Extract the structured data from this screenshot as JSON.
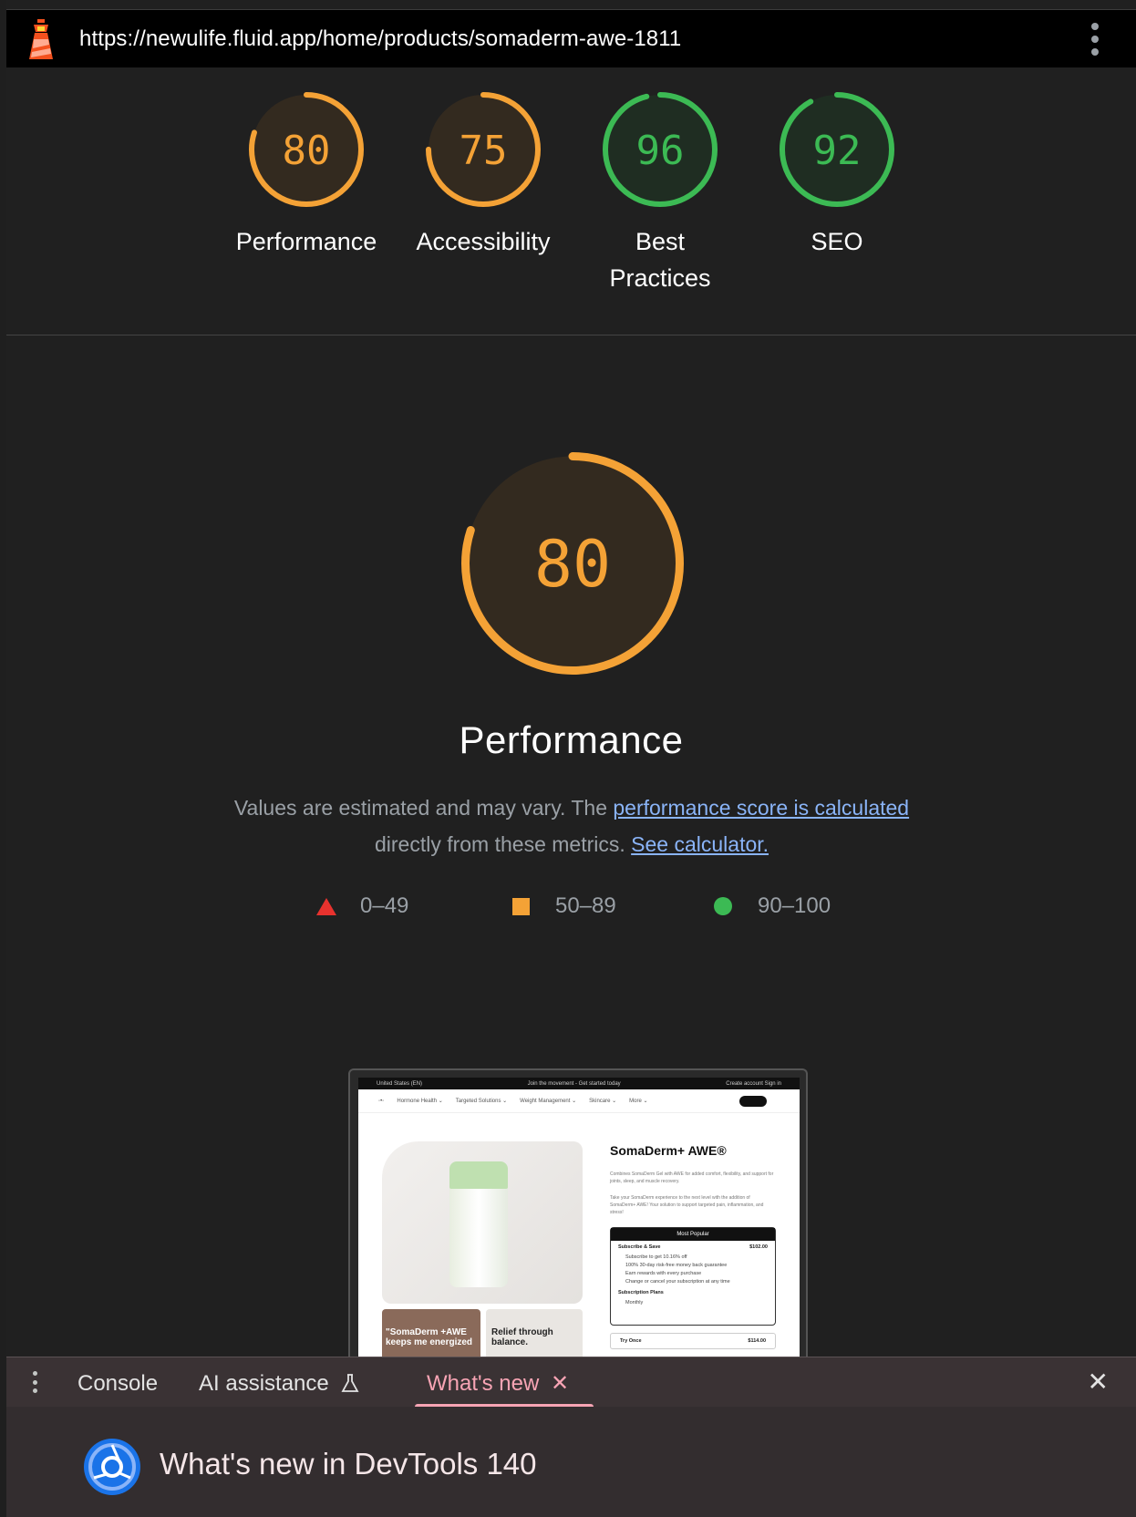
{
  "url_bar": {
    "url": "https://newulife.fluid.app/home/products/somaderm-awe-1811"
  },
  "scores": [
    {
      "label": "Performance",
      "score": "80",
      "value": 80,
      "color": "#f4a236",
      "bg": "#332a1f"
    },
    {
      "label": "Accessibility",
      "score": "75",
      "value": 75,
      "color": "#f4a236",
      "bg": "#332a1f"
    },
    {
      "label": "Best Practices",
      "score": "96",
      "value": 96,
      "color": "#3cba54",
      "bg": "#1f2d22"
    },
    {
      "label": "SEO",
      "score": "92",
      "value": 92,
      "color": "#3cba54",
      "bg": "#1f2d22"
    }
  ],
  "performance": {
    "score": "80",
    "value": 80,
    "title": "Performance",
    "desc_prefix": "Values are estimated and may vary. The ",
    "link1": "performance score is calculated",
    "desc_middle": " directly from these metrics. ",
    "link2": "See calculator."
  },
  "legend": {
    "fail": "0–49",
    "average": "50–89",
    "pass": "90–100"
  },
  "screenshot": {
    "top_left": "United States (EN)",
    "top_center": "Join the movement - Get started today",
    "top_right": "Create account   Sign in",
    "nav": [
      "Hormone Health ⌄",
      "Targeted Solutions ⌄",
      "Weight Management ⌄",
      "Skincare ⌄",
      "More ⌄"
    ],
    "product_title": "SomaDerm+ AWE®",
    "desc1": "Combines SomaDerm Gel with AWE for added comfort, flexibility, and support for joints, sleep, and muscle recovery.",
    "desc2": "Take your SomaDerm experience to the next level with the addition of SomaDerm+ AWE! Your solution to support targeted pain, inflammation, and stress!",
    "box_head": "Most Popular",
    "subscribe_label": "Subscribe & Save",
    "subscribe_price": "$102.00",
    "bullets": [
      "Subscribe to get 10.16% off",
      "100% 30-day risk-free money back guarantee",
      "Earn rewards with every purchase",
      "Change or cancel your subscription at any time"
    ],
    "plans_label": "Subscription Plans",
    "plans_value": "Monthly",
    "try_label": "Try Once",
    "try_price": "$114.00",
    "card1": "\"SomaDerm +AWE keeps me energized",
    "card2": "Relief through balance."
  },
  "drawer": {
    "tabs": {
      "console": "Console",
      "ai": "AI assistance",
      "whats_new": "What's new"
    },
    "heading": "What's new in DevTools 140"
  }
}
